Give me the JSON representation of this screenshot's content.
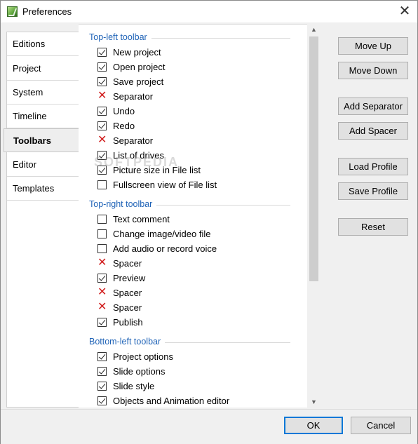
{
  "window": {
    "title": "Preferences",
    "close_glyph": "✕",
    "app_icon": "preferences-app-icon"
  },
  "sidebar": {
    "tabs": [
      {
        "label": "Editions",
        "active": false
      },
      {
        "label": "Project",
        "active": false
      },
      {
        "label": "System",
        "active": false
      },
      {
        "label": "Timeline",
        "active": false
      },
      {
        "label": "Toolbars",
        "active": true
      },
      {
        "label": "Editor",
        "active": false
      },
      {
        "label": "Templates",
        "active": false
      }
    ]
  },
  "watermark": "SOFTPEDIA",
  "sections": [
    {
      "title": "Top-left toolbar",
      "items": [
        {
          "label": "New project",
          "state": "checked"
        },
        {
          "label": "Open project",
          "state": "checked"
        },
        {
          "label": "Save project",
          "state": "checked"
        },
        {
          "label": "Separator",
          "state": "remove"
        },
        {
          "label": "Undo",
          "state": "checked"
        },
        {
          "label": "Redo",
          "state": "checked"
        },
        {
          "label": "Separator",
          "state": "remove"
        },
        {
          "label": "List of drives",
          "state": "checked"
        },
        {
          "label": "Picture size in File list",
          "state": "checked"
        },
        {
          "label": "Fullscreen view of File list",
          "state": "unchecked"
        }
      ]
    },
    {
      "title": "Top-right toolbar",
      "items": [
        {
          "label": "Text comment",
          "state": "unchecked"
        },
        {
          "label": "Change image/video file",
          "state": "unchecked"
        },
        {
          "label": "Add audio or record voice",
          "state": "unchecked"
        },
        {
          "label": "Spacer",
          "state": "remove"
        },
        {
          "label": "Preview",
          "state": "checked"
        },
        {
          "label": "Spacer",
          "state": "remove"
        },
        {
          "label": "Spacer",
          "state": "remove"
        },
        {
          "label": "Publish",
          "state": "checked"
        }
      ]
    },
    {
      "title": "Bottom-left toolbar",
      "items": [
        {
          "label": "Project options",
          "state": "checked"
        },
        {
          "label": "Slide options",
          "state": "checked"
        },
        {
          "label": "Slide style",
          "state": "checked"
        },
        {
          "label": "Objects and Animation editor",
          "state": "checked"
        }
      ]
    }
  ],
  "remove_glyph": "✕",
  "scrollbar": {
    "up_glyph": "▲",
    "down_glyph": "▼"
  },
  "buttons": {
    "move_up": "Move Up",
    "move_down": "Move Down",
    "add_separator": "Add Separator",
    "add_spacer": "Add Spacer",
    "load_profile": "Load Profile",
    "save_profile": "Save Profile",
    "reset": "Reset",
    "ok": "OK",
    "cancel": "Cancel"
  },
  "colors": {
    "section_header": "#1f63b7",
    "remove_mark": "#d11e1e",
    "default_button_border": "#0078d7"
  }
}
